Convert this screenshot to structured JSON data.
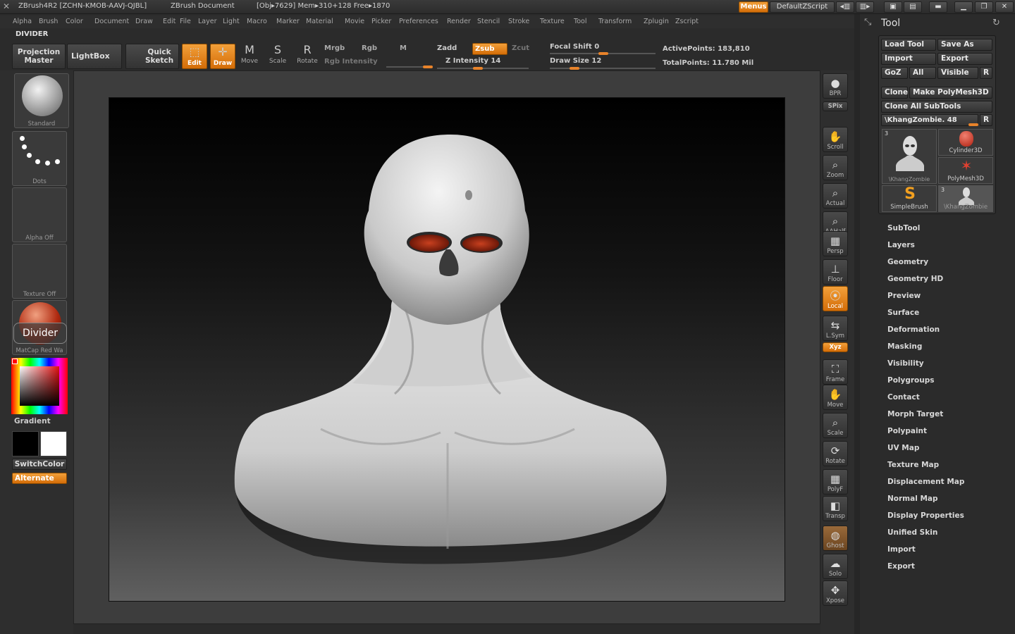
{
  "titlebar": {
    "app": "ZBrush4R2 [ZCHN-KMOB-AAVJ-QJBL]",
    "doc": "ZBrush Document",
    "stats": "[Obj▸7629] Mem▸310+128 Free▸1870",
    "menus_btn": "Menus",
    "script_btn": "DefaultZScript"
  },
  "menubar": [
    "Alpha",
    "Brush",
    "Color",
    "Document",
    "Draw",
    "Edit",
    "File",
    "Layer",
    "Light",
    "Macro",
    "Marker",
    "Material",
    "Movie",
    "Picker",
    "Preferences",
    "Render",
    "Stencil",
    "Stroke",
    "Texture",
    "Tool",
    "Transform",
    "Zplugin",
    "Zscript"
  ],
  "palette_name": "DIVIDER",
  "toolbar": {
    "projection_master": [
      "Projection",
      "Master"
    ],
    "lightbox": "LightBox",
    "quick_sketch": [
      "Quick",
      "Sketch"
    ],
    "edit": "Edit",
    "draw": "Draw",
    "move": "Move",
    "scale": "Scale",
    "rotate": "Rotate",
    "mrgb": "Mrgb",
    "rgb": "Rgb",
    "m": "M",
    "rgb_intensity": "Rgb Intensity",
    "zadd": "Zadd",
    "zsub": "Zsub",
    "zcut": "Zcut",
    "z_intensity": "Z Intensity 14",
    "focal_shift": "Focal Shift 0",
    "draw_size": "Draw Size 12",
    "active_points": "ActivePoints: 183,810",
    "total_points": "TotalPoints: 11.780 Mil"
  },
  "left_shelf": {
    "brush": "Standard",
    "stroke": "Dots",
    "alpha": "Alpha  Off",
    "texture": "Texture  Off",
    "material": "MatCap  Red  Wa",
    "tooltip": "Divider",
    "gradient": "Gradient",
    "switch_color": "SwitchColor",
    "alternate": "Alternate"
  },
  "right_shelf": [
    "BPR",
    "SPix",
    "Scroll",
    "Zoom",
    "Actual",
    "AAHalf",
    "Persp",
    "Floor",
    "Local",
    "L.Sym",
    "Xyz",
    "Frame",
    "Move",
    "Scale",
    "Rotate",
    "PolyF",
    "Transp",
    "Ghost",
    "Solo",
    "Xpose"
  ],
  "tool_panel": {
    "title": "Tool",
    "load_tool": "Load Tool",
    "save_as": "Save As",
    "import": "Import",
    "export": "Export",
    "goz": "GoZ",
    "all": "All",
    "visible": "Visible",
    "r": "R",
    "clone": "Clone",
    "make_polymesh": "Make PolyMesh3D",
    "clone_all": "Clone All SubTools",
    "current_tool": "\\KhangZombie. 48",
    "tools": [
      {
        "label": "\\KhangZombie",
        "count": "3"
      },
      {
        "label": "Cylinder3D"
      },
      {
        "label": "PolyMesh3D"
      },
      {
        "label": "SimpleBrush"
      },
      {
        "label": "\\KhangZombie",
        "count": "3"
      }
    ],
    "subpalettes": [
      "SubTool",
      "Layers",
      "Geometry",
      "Geometry HD",
      "Preview",
      "Surface",
      "Deformation",
      "Masking",
      "Visibility",
      "Polygroups",
      "Contact",
      "Morph Target",
      "Polypaint",
      "UV Map",
      "Texture Map",
      "Displacement Map",
      "Normal Map",
      "Display Properties",
      "Unified Skin",
      "Import",
      "Export"
    ]
  },
  "colors": {
    "accent": "#e8832a",
    "panel": "#2b2b2b",
    "button": "#3c3c3c"
  }
}
